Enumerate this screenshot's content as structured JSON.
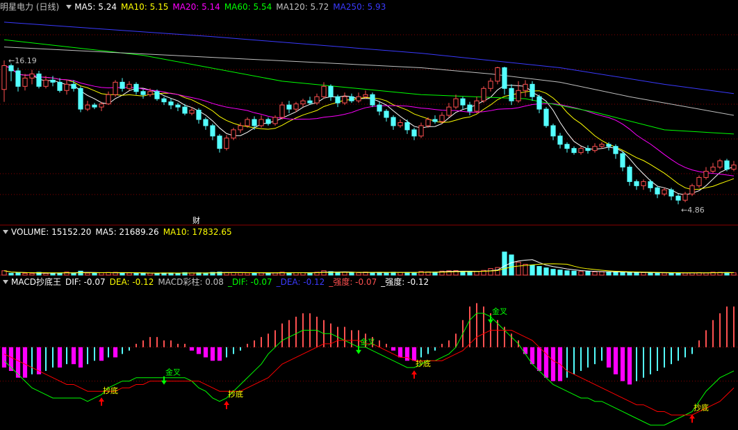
{
  "colors": {
    "background": "#000000",
    "up": "#ff5050",
    "down": "#54ffff",
    "ma5": "#ffffff",
    "ma10": "#ffff00",
    "ma20": "#ff00ff",
    "ma60": "#00ff00",
    "ma120": "#c0c0c0",
    "ma250": "#3a3aff",
    "grid": "#8b0000",
    "dif": "#00ff00",
    "dea": "#ff0000",
    "dea_blue": "#3a3aff",
    "hist_pos": "#ff5050",
    "hist_neg": "#ff00ff",
    "hist_neg_light": "#54ffff"
  },
  "price_header": {
    "title": "明星电力 (日线)",
    "items": [
      {
        "label": "MA5: 5.24",
        "color": "#ffffff"
      },
      {
        "label": "MA10: 5.15",
        "color": "#ffff00"
      },
      {
        "label": "MA20: 5.14",
        "color": "#ff00ff"
      },
      {
        "label": "MA60: 5.54",
        "color": "#00ff00"
      },
      {
        "label": "MA120: 5.72",
        "color": "#c0c0c0"
      },
      {
        "label": "MA250: 5.93",
        "color": "#3a3aff"
      }
    ]
  },
  "volume_header": {
    "items": [
      {
        "label": "VOLUME: 15152.20",
        "color": "#ffffff"
      },
      {
        "label": "MA5: 21689.26",
        "color": "#ffffff"
      },
      {
        "label": "MA10: 17832.65",
        "color": "#ffff00"
      }
    ]
  },
  "macd_header": {
    "items": [
      {
        "label": "MACD抄底王",
        "color": "#ffffff"
      },
      {
        "label": "DIF: -0.07",
        "color": "#ffffff"
      },
      {
        "label": "DEA: -0.12",
        "color": "#ffff00"
      },
      {
        "label": "MACD彩柱: 0.08",
        "color": "#c0c0c0"
      },
      {
        "label": "_DIF: -0.07",
        "color": "#00ff00"
      },
      {
        "label": "_DEA: -0.12",
        "color": "#3a3aff"
      },
      {
        "label": "_强度: -0.07",
        "color": "#ff5050"
      },
      {
        "label": "_强度: -0.12",
        "color": "#ffffff"
      }
    ]
  },
  "chart_data": {
    "type": "candlestick",
    "price_range": [
      4.7,
      6.7
    ],
    "high_label": "16.19",
    "low_label": "4.86",
    "event_label": "财",
    "signal_labels": {
      "bottom": "抄底",
      "golden": "金叉"
    },
    "candles": [
      [
        5.97,
        6.2,
        6.25,
        5.85
      ],
      [
        6.2,
        6.15,
        6.22,
        6.05
      ],
      [
        6.15,
        6.0,
        6.18,
        5.95
      ],
      [
        6.0,
        6.08,
        6.12,
        5.96
      ],
      [
        6.08,
        6.12,
        6.16,
        6.02
      ],
      [
        6.12,
        6.0,
        6.15,
        5.98
      ],
      [
        6.0,
        6.06,
        6.1,
        5.98
      ],
      [
        6.06,
        6.04,
        6.1,
        6.0
      ],
      [
        6.04,
        5.96,
        6.08,
        5.94
      ],
      [
        5.96,
        6.02,
        6.06,
        5.92
      ],
      [
        6.02,
        5.98,
        6.06,
        5.95
      ],
      [
        5.98,
        5.78,
        6.0,
        5.75
      ],
      [
        5.78,
        5.82,
        5.86,
        5.76
      ],
      [
        5.82,
        5.8,
        5.84,
        5.78
      ],
      [
        5.8,
        5.83,
        5.85,
        5.76
      ],
      [
        5.83,
        5.92,
        5.95,
        5.82
      ],
      [
        5.92,
        6.04,
        6.06,
        5.9
      ],
      [
        6.04,
        5.98,
        6.08,
        5.95
      ],
      [
        5.98,
        6.02,
        6.05,
        5.96
      ],
      [
        6.02,
        5.95,
        6.04,
        5.92
      ],
      [
        5.95,
        5.92,
        5.97,
        5.88
      ],
      [
        5.92,
        5.95,
        5.98,
        5.9
      ],
      [
        5.95,
        5.88,
        5.97,
        5.86
      ],
      [
        5.88,
        5.85,
        5.9,
        5.82
      ],
      [
        5.85,
        5.82,
        5.88,
        5.78
      ],
      [
        5.82,
        5.8,
        5.84,
        5.76
      ],
      [
        5.8,
        5.74,
        5.83,
        5.72
      ],
      [
        5.74,
        5.77,
        5.8,
        5.72
      ],
      [
        5.77,
        5.68,
        5.79,
        5.64
      ],
      [
        5.68,
        5.62,
        5.7,
        5.58
      ],
      [
        5.62,
        5.52,
        5.64,
        5.48
      ],
      [
        5.52,
        5.4,
        5.54,
        5.36
      ],
      [
        5.4,
        5.5,
        5.53,
        5.38
      ],
      [
        5.5,
        5.58,
        5.6,
        5.48
      ],
      [
        5.58,
        5.62,
        5.65,
        5.55
      ],
      [
        5.62,
        5.68,
        5.7,
        5.6
      ],
      [
        5.68,
        5.62,
        5.71,
        5.58
      ],
      [
        5.62,
        5.68,
        5.72,
        5.6
      ],
      [
        5.68,
        5.64,
        5.7,
        5.62
      ],
      [
        5.64,
        5.7,
        5.72,
        5.62
      ],
      [
        5.7,
        5.82,
        5.85,
        5.68
      ],
      [
        5.82,
        5.78,
        5.86,
        5.74
      ],
      [
        5.78,
        5.83,
        5.85,
        5.75
      ],
      [
        5.83,
        5.86,
        5.88,
        5.8
      ],
      [
        5.86,
        5.84,
        5.9,
        5.82
      ],
      [
        5.84,
        5.9,
        5.93,
        5.82
      ],
      [
        5.9,
        6.0,
        6.04,
        5.88
      ],
      [
        6.0,
        5.9,
        6.02,
        5.86
      ],
      [
        5.9,
        5.84,
        5.92,
        5.8
      ],
      [
        5.84,
        5.9,
        5.94,
        5.82
      ],
      [
        5.9,
        5.86,
        5.93,
        5.84
      ],
      [
        5.86,
        5.9,
        5.94,
        5.84
      ],
      [
        5.9,
        5.92,
        5.96,
        5.88
      ],
      [
        5.92,
        5.82,
        5.94,
        5.8
      ],
      [
        5.82,
        5.76,
        5.85,
        5.72
      ],
      [
        5.76,
        5.7,
        5.78,
        5.66
      ],
      [
        5.7,
        5.62,
        5.72,
        5.58
      ],
      [
        5.62,
        5.65,
        5.68,
        5.6
      ],
      [
        5.65,
        5.58,
        5.68,
        5.54
      ],
      [
        5.58,
        5.52,
        5.6,
        5.48
      ],
      [
        5.52,
        5.62,
        5.65,
        5.5
      ],
      [
        5.62,
        5.68,
        5.7,
        5.6
      ],
      [
        5.68,
        5.66,
        5.72,
        5.64
      ],
      [
        5.66,
        5.72,
        5.75,
        5.64
      ],
      [
        5.72,
        5.8,
        5.84,
        5.7
      ],
      [
        5.8,
        5.88,
        5.92,
        5.78
      ],
      [
        5.88,
        5.82,
        5.9,
        5.78
      ],
      [
        5.82,
        5.76,
        5.85,
        5.72
      ],
      [
        5.76,
        5.86,
        5.9,
        5.74
      ],
      [
        5.86,
        5.98,
        6.0,
        5.84
      ],
      [
        5.98,
        6.05,
        6.08,
        5.95
      ],
      [
        6.05,
        6.18,
        6.19,
        6.02
      ],
      [
        6.18,
        5.98,
        6.19,
        5.92
      ],
      [
        5.98,
        5.86,
        6.02,
        5.82
      ],
      [
        5.86,
        5.96,
        6.05,
        5.84
      ],
      [
        5.96,
        6.02,
        6.06,
        5.9
      ],
      [
        6.02,
        5.9,
        6.05,
        5.86
      ],
      [
        5.9,
        5.78,
        5.92,
        5.74
      ],
      [
        5.78,
        5.62,
        5.8,
        5.6
      ],
      [
        5.62,
        5.52,
        5.64,
        5.48
      ],
      [
        5.52,
        5.44,
        5.55,
        5.4
      ],
      [
        5.44,
        5.4,
        5.46,
        5.36
      ],
      [
        5.4,
        5.36,
        5.42,
        5.34
      ],
      [
        5.36,
        5.4,
        5.42,
        5.34
      ],
      [
        5.4,
        5.38,
        5.43,
        5.35
      ],
      [
        5.38,
        5.42,
        5.45,
        5.36
      ],
      [
        5.42,
        5.44,
        5.46,
        5.4
      ],
      [
        5.44,
        5.42,
        5.46,
        5.38
      ],
      [
        5.42,
        5.35,
        5.44,
        5.3
      ],
      [
        5.35,
        5.22,
        5.37,
        5.18
      ],
      [
        5.22,
        5.08,
        5.24,
        5.04
      ],
      [
        5.08,
        5.04,
        5.1,
        5.0
      ],
      [
        5.04,
        5.08,
        5.1,
        5.0
      ],
      [
        5.08,
        5.02,
        5.1,
        4.98
      ],
      [
        5.02,
        4.96,
        5.04,
        4.92
      ],
      [
        4.96,
        5.0,
        5.02,
        4.94
      ],
      [
        5.0,
        4.94,
        5.02,
        4.9
      ],
      [
        4.94,
        4.9,
        4.96,
        4.86
      ],
      [
        4.9,
        4.96,
        4.98,
        4.88
      ],
      [
        4.96,
        5.04,
        5.06,
        4.94
      ],
      [
        5.04,
        5.12,
        5.14,
        5.02
      ],
      [
        5.12,
        5.18,
        5.22,
        5.1
      ],
      [
        5.18,
        5.22,
        5.26,
        5.16
      ],
      [
        5.22,
        5.28,
        5.3,
        5.2
      ],
      [
        5.28,
        5.2,
        5.3,
        5.18
      ],
      [
        5.2,
        5.24,
        5.28,
        5.18
      ]
    ],
    "volume_range": [
      0,
      52000
    ],
    "volume": [
      6000,
      2500,
      3000,
      2500,
      2200,
      3800,
      2400,
      3000,
      3000,
      4200,
      3000,
      5500,
      2800,
      2500,
      3200,
      3600,
      3800,
      3000,
      3000,
      2500,
      2600,
      2800,
      2400,
      3000,
      3000,
      2500,
      3500,
      3000,
      3200,
      3000,
      3800,
      4200,
      3600,
      3500,
      3200,
      3000,
      2800,
      3000,
      3000,
      3000,
      4000,
      3200,
      3400,
      3400,
      3000,
      4000,
      6000,
      4800,
      3500,
      3800,
      3000,
      3200,
      4200,
      3600,
      3400,
      3600,
      4000,
      3800,
      3800,
      3500,
      5000,
      4500,
      4200,
      5500,
      6000,
      6200,
      5000,
      4500,
      5000,
      6500,
      9000,
      10500,
      32000,
      28000,
      18000,
      15000,
      14000,
      12000,
      10000,
      8000,
      7000,
      6000,
      5500,
      5000,
      4800,
      4500,
      4500,
      4200,
      4000,
      3800,
      3600,
      3500,
      3400,
      3200,
      3000,
      3000,
      3200,
      3000,
      2800,
      3200,
      3500,
      3000,
      4000,
      3800,
      3500,
      3200
    ],
    "macd_range": [
      -0.23,
      0.18
    ],
    "macd_hist": [
      -0.06,
      -0.07,
      -0.09,
      -0.09,
      -0.08,
      -0.08,
      -0.07,
      -0.06,
      -0.06,
      -0.05,
      -0.05,
      -0.06,
      -0.05,
      -0.04,
      -0.04,
      -0.03,
      -0.03,
      -0.02,
      -0.01,
      0.01,
      0.02,
      0.03,
      0.03,
      0.02,
      0.02,
      0.01,
      0.01,
      -0.01,
      -0.02,
      -0.03,
      -0.04,
      -0.04,
      -0.03,
      -0.02,
      -0.01,
      0.01,
      0.02,
      0.03,
      0.04,
      0.05,
      0.07,
      0.08,
      0.09,
      0.1,
      0.1,
      0.09,
      0.08,
      0.07,
      0.06,
      0.06,
      0.05,
      0.05,
      0.04,
      0.03,
      0.02,
      0.01,
      -0.01,
      -0.03,
      -0.04,
      -0.04,
      -0.03,
      -0.02,
      -0.01,
      0.01,
      0.02,
      0.04,
      0.08,
      0.12,
      0.13,
      0.12,
      0.1,
      0.08,
      0.06,
      0.04,
      0.02,
      -0.02,
      -0.05,
      -0.07,
      -0.09,
      -0.1,
      -0.1,
      -0.09,
      -0.08,
      -0.07,
      -0.06,
      -0.05,
      -0.04,
      -0.06,
      -0.08,
      -0.1,
      -0.11,
      -0.1,
      -0.09,
      -0.08,
      -0.07,
      -0.06,
      -0.05,
      -0.04,
      -0.03,
      -0.02,
      0.02,
      0.05,
      0.08,
      0.1,
      0.12,
      0.12
    ],
    "dif": [
      -0.04,
      -0.06,
      -0.08,
      -0.1,
      -0.12,
      -0.13,
      -0.14,
      -0.15,
      -0.15,
      -0.15,
      -0.15,
      -0.15,
      -0.16,
      -0.15,
      -0.14,
      -0.12,
      -0.11,
      -0.1,
      -0.1,
      -0.09,
      -0.09,
      -0.09,
      -0.09,
      -0.09,
      -0.09,
      -0.09,
      -0.09,
      -0.1,
      -0.12,
      -0.13,
      -0.15,
      -0.16,
      -0.15,
      -0.13,
      -0.11,
      -0.09,
      -0.07,
      -0.05,
      -0.02,
      0.0,
      0.02,
      0.03,
      0.04,
      0.05,
      0.05,
      0.05,
      0.04,
      0.04,
      0.03,
      0.02,
      0.01,
      0.0,
      0.0,
      -0.01,
      -0.02,
      -0.03,
      -0.04,
      -0.05,
      -0.06,
      -0.06,
      -0.05,
      -0.04,
      -0.04,
      -0.03,
      -0.02,
      0.0,
      0.04,
      0.08,
      0.1,
      0.1,
      0.09,
      0.07,
      0.05,
      0.03,
      0.01,
      -0.02,
      -0.05,
      -0.07,
      -0.09,
      -0.11,
      -0.12,
      -0.13,
      -0.14,
      -0.15,
      -0.15,
      -0.16,
      -0.16,
      -0.17,
      -0.18,
      -0.19,
      -0.2,
      -0.21,
      -0.22,
      -0.23,
      -0.23,
      -0.23,
      -0.22,
      -0.21,
      -0.2,
      -0.19,
      -0.16,
      -0.13,
      -0.11,
      -0.09,
      -0.08,
      -0.07
    ],
    "dea": [
      -0.02,
      -0.03,
      -0.04,
      -0.05,
      -0.06,
      -0.07,
      -0.08,
      -0.09,
      -0.1,
      -0.11,
      -0.11,
      -0.12,
      -0.13,
      -0.13,
      -0.13,
      -0.13,
      -0.13,
      -0.12,
      -0.12,
      -0.11,
      -0.11,
      -0.1,
      -0.1,
      -0.1,
      -0.1,
      -0.1,
      -0.1,
      -0.1,
      -0.1,
      -0.11,
      -0.12,
      -0.13,
      -0.13,
      -0.13,
      -0.13,
      -0.12,
      -0.11,
      -0.1,
      -0.09,
      -0.07,
      -0.05,
      -0.04,
      -0.03,
      -0.02,
      -0.01,
      0.0,
      0.01,
      0.01,
      0.02,
      0.02,
      0.02,
      0.02,
      0.01,
      0.01,
      0.0,
      -0.01,
      -0.02,
      -0.03,
      -0.03,
      -0.04,
      -0.04,
      -0.04,
      -0.04,
      -0.04,
      -0.03,
      -0.02,
      -0.01,
      0.01,
      0.03,
      0.04,
      0.05,
      0.05,
      0.05,
      0.05,
      0.04,
      0.03,
      0.02,
      0.0,
      -0.02,
      -0.04,
      -0.05,
      -0.07,
      -0.08,
      -0.09,
      -0.1,
      -0.11,
      -0.12,
      -0.13,
      -0.14,
      -0.15,
      -0.16,
      -0.17,
      -0.17,
      -0.18,
      -0.19,
      -0.19,
      -0.2,
      -0.2,
      -0.2,
      -0.2,
      -0.19,
      -0.18,
      -0.17,
      -0.16,
      -0.14,
      -0.12
    ],
    "signals": [
      {
        "index": 14,
        "type": "bottom"
      },
      {
        "index": 23,
        "type": "golden"
      },
      {
        "index": 32,
        "type": "bottom"
      },
      {
        "index": 51,
        "type": "golden"
      },
      {
        "index": 59,
        "type": "bottom"
      },
      {
        "index": 70,
        "type": "golden"
      },
      {
        "index": 99,
        "type": "bottom"
      }
    ],
    "ma_overlays": [
      {
        "name": "MA60",
        "points": [
          [
            0,
            6.45
          ],
          [
            20,
            6.3
          ],
          [
            40,
            6.05
          ],
          [
            60,
            5.92
          ],
          [
            75,
            5.88
          ],
          [
            85,
            5.75
          ],
          [
            95,
            5.58
          ],
          [
            105,
            5.54
          ]
        ]
      },
      {
        "name": "MA120",
        "points": [
          [
            0,
            6.38
          ],
          [
            30,
            6.28
          ],
          [
            60,
            6.18
          ],
          [
            70,
            6.12
          ],
          [
            80,
            6.04
          ],
          [
            90,
            5.9
          ],
          [
            105,
            5.72
          ]
        ]
      },
      {
        "name": "MA250",
        "points": [
          [
            0,
            6.62
          ],
          [
            30,
            6.48
          ],
          [
            60,
            6.32
          ],
          [
            80,
            6.18
          ],
          [
            95,
            6.02
          ],
          [
            105,
            5.93
          ]
        ]
      }
    ]
  }
}
